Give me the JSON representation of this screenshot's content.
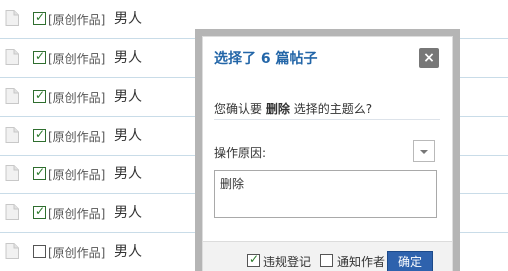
{
  "threads": [
    {
      "category": "[原创作品]",
      "title": "男人",
      "checked": true
    },
    {
      "category": "[原创作品]",
      "title": "男人",
      "checked": true
    },
    {
      "category": "[原创作品]",
      "title": "男人",
      "checked": true
    },
    {
      "category": "[原创作品]",
      "title": "男人",
      "checked": true
    },
    {
      "category": "[原创作品]",
      "title": "男人",
      "checked": true
    },
    {
      "category": "[原创作品]",
      "title": "男人",
      "checked": true
    },
    {
      "category": "[原创作品]",
      "title": "男人",
      "checked": false
    }
  ],
  "modal": {
    "title": "选择了 6 篇帖子",
    "close_label": "×",
    "confirm_prefix": "您确认要",
    "confirm_action": "删除",
    "confirm_suffix": "选择的主题么?",
    "reason_label": "操作原因:",
    "reason_text": "删除",
    "violation_label": "违规登记",
    "violation_checked": true,
    "notify_label": "通知作者",
    "notify_checked": false,
    "confirm_button": "确定"
  },
  "colors": {
    "title_blue": "#2366a8",
    "button_blue": "#2e62ad",
    "check_green": "#2a7a2a"
  }
}
